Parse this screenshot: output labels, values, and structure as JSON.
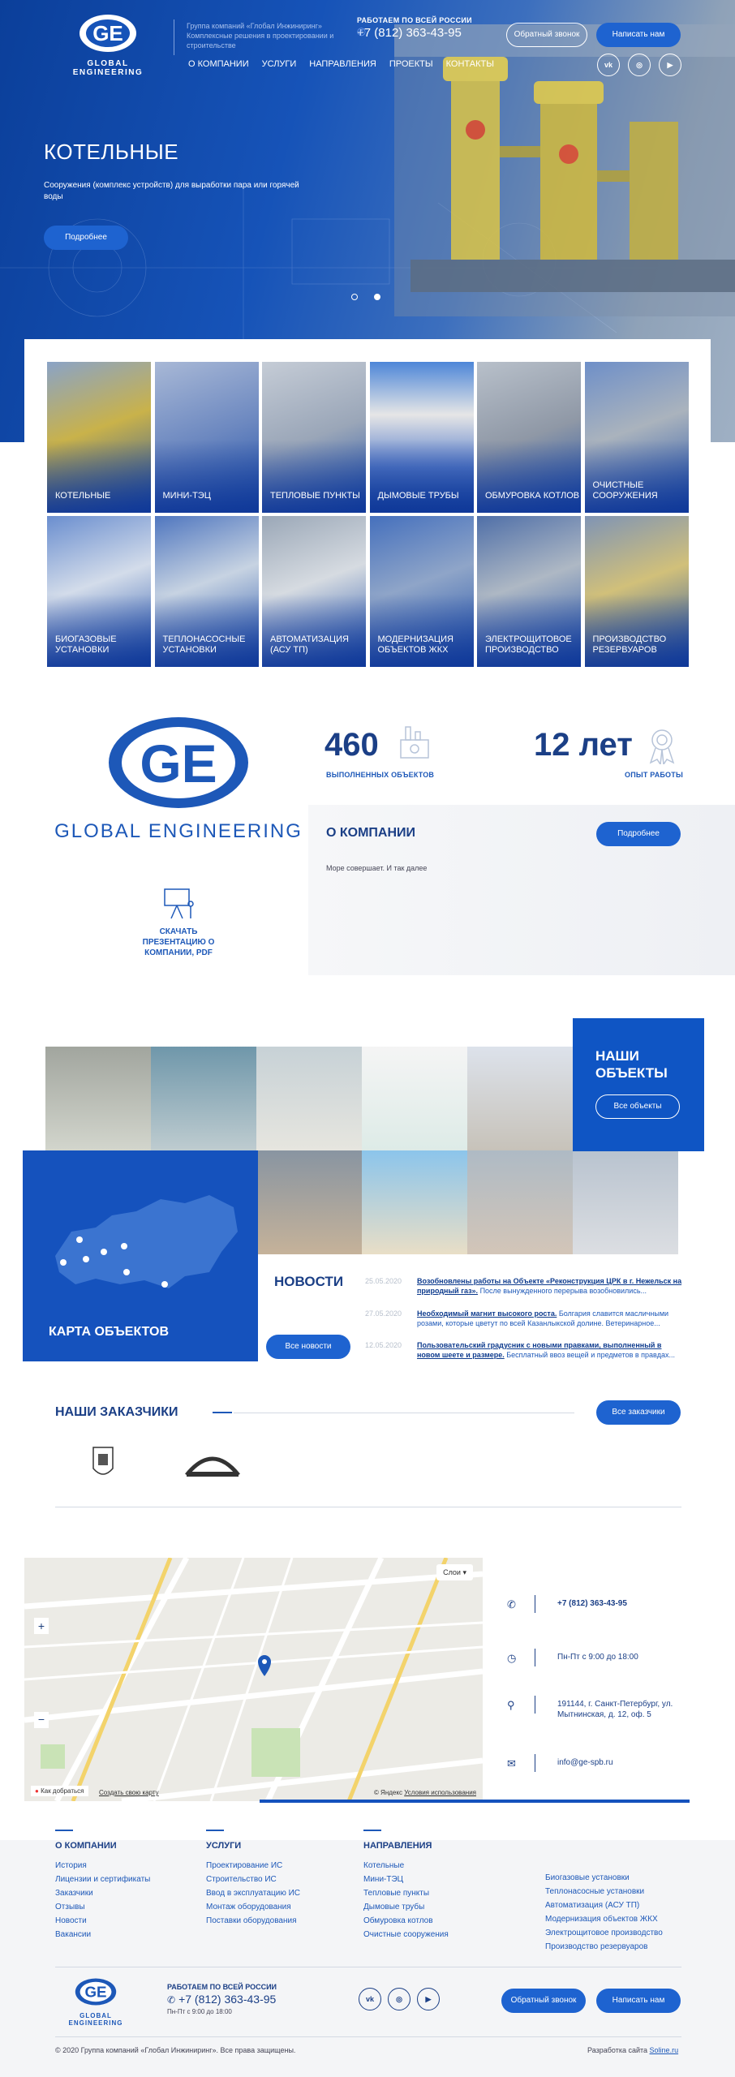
{
  "header": {
    "brand": "GLOBAL ENGINEERING",
    "tagline": "Группа компаний «Глобал Инжиниринг» Комплексные решения в проектировании и строительстве",
    "work_hours_title": "РАБОТАЕМ ПО ВСЕЙ РОССИИ",
    "phone": "+7 (812) 363-43-95",
    "callback_btn": "Обратный звонок",
    "write_btn": "Написать нам",
    "nav": [
      "О КОМПАНИИ",
      "УСЛУГИ",
      "НАПРАВЛЕНИЯ",
      "ПРОЕКТЫ",
      "КОНТАКТЫ"
    ],
    "social": [
      "vk-icon",
      "instagram-icon",
      "youtube-icon"
    ]
  },
  "hero": {
    "title": "КОТЕЛЬНЫЕ",
    "subtitle": "Сооружения (комплекс устройств) для выработки пара или горячей воды",
    "more_btn": "Подробнее",
    "slides": 2,
    "active_slide": 2
  },
  "tiles": [
    "КОТЕЛЬНЫЕ",
    "МИНИ-ТЭЦ",
    "ТЕПЛОВЫЕ ПУНКТЫ",
    "ДЫМОВЫЕ ТРУБЫ",
    "ОБМУРОВКА КОТЛОВ",
    "ОЧИСТНЫЕ СООРУЖЕНИЯ",
    "БИОГАЗОВЫЕ УСТАНОВКИ",
    "ТЕПЛОНАСОСНЫЕ УСТАНОВКИ",
    "АВТОМАТИЗАЦИЯ (АСУ ТП)",
    "МОДЕРНИЗАЦИЯ ОБЪЕКТОВ ЖКХ",
    "ЭЛЕКТРОЩИТОВОЕ ПРОИЗВОДСТВО",
    "ПРОИЗВОДСТВО РЕЗЕРВУАРОВ"
  ],
  "stats": {
    "objects_num": "460",
    "objects_label": "ВЫПОЛНЕННЫХ ОБЪЕКТОВ",
    "years_num": "12 лет",
    "years_label": "ОПЫТ РАБОТЫ"
  },
  "about": {
    "brand": "GLOBAL ENGINEERING",
    "download": "СКАЧАТЬ ПРЕЗЕНТАЦИЮ О КОМПАНИИ, PDF",
    "title": "О КОМПАНИИ",
    "text": "Море совершает. И так далее",
    "more_btn": "Подробнее"
  },
  "objects": {
    "title": "НАШИ ОБЪЕКТЫ",
    "all_btn": "Все объекты",
    "map_title": "КАРТА ОБЪЕКТОВ"
  },
  "news": {
    "title": "НОВОСТИ",
    "all_btn": "Все новости",
    "items": [
      {
        "date": "25.05.2020",
        "bold": "Возобновлены работы на Объекте «Реконструкция ЦРК в г. Нежельск на природный газ».",
        "rest": " После вынужденного перерыва возобновились..."
      },
      {
        "date": "27.05.2020",
        "bold": "Необходимый магнит высокого роста.",
        "rest": " Болгария славится масличными розами, которые цветут по всей Казанлыкской долине. Ветеринарное..."
      },
      {
        "date": "12.05.2020",
        "bold": "Пользовательский градусник с новыми правками, выполненный в новом шеете и размере.",
        "rest": " Бесплатный ввоз вещей и предметов в правдах..."
      }
    ]
  },
  "customers": {
    "title": "НАШИ ЗАКАЗЧИКИ",
    "all_btn": "Все заказчики"
  },
  "map": {
    "layers": "Слои",
    "route": "Как добраться",
    "create": "Создать свою карту",
    "copyright": "© Яндекс",
    "terms": "Условия использования"
  },
  "contacts": {
    "phone": "+7 (812) 363-43-95",
    "hours": "Пн-Пт с 9:00 до 18:00",
    "address": "191144, г. Санкт-Петербург, ул. Мытнинская, д. 12, оф. 5",
    "email": "info@ge-spb.ru"
  },
  "footer": {
    "col1_title": "О КОМПАНИИ",
    "col1": [
      "История",
      "Лицензии и сертификаты",
      "Заказчики",
      "Отзывы",
      "Новости",
      "Вакансии"
    ],
    "col2_title": "УСЛУГИ",
    "col2": [
      "Проектирование ИС",
      "Строительство ИС",
      "Ввод в эксплуатацию ИС",
      "Монтаж оборудования",
      "Поставки оборудования"
    ],
    "col3_title": "НАПРАВЛЕНИЯ",
    "col3": [
      "Котельные",
      "Мини-ТЭЦ",
      "Тепловые пункты",
      "Дымовые трубы",
      "Обмуровка котлов",
      "Очистные сооружения"
    ],
    "col4": [
      "Биогазовые установки",
      "Теплонасосные установки",
      "Автоматизация (АСУ ТП)",
      "Модернизация объектов ЖКХ",
      "Электрощитовое производство",
      "Производство резервуаров"
    ],
    "brand": "GLOBAL ENGINEERING",
    "work_title": "РАБОТАЕМ ПО ВСЕЙ РОССИИ",
    "phone": "+7 (812) 363-43-95",
    "hours": "Пн-Пт с 9:00 до 18:00",
    "callback_btn": "Обратный звонок",
    "write_btn": "Написать нам",
    "copyright": "© 2020 Группа компаний «Глобал Инжиниринг». Все права защищены.",
    "dev_label": "Разработка сайта",
    "dev_name": "Soline.ru"
  }
}
